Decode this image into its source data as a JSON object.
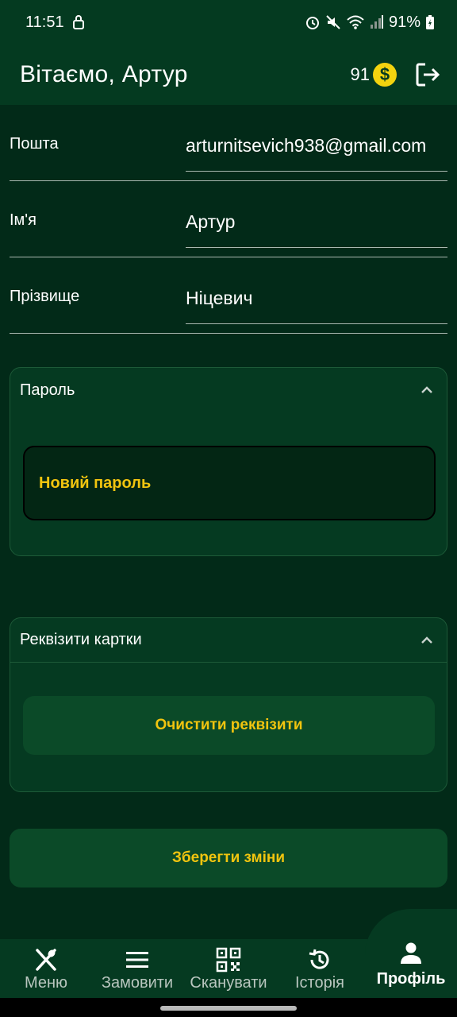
{
  "status": {
    "time": "11:51",
    "battery": "91%"
  },
  "header": {
    "title": "Вітаємо, Артур",
    "balance": "91",
    "coin_symbol": "$"
  },
  "form": {
    "email_label": "Пошта",
    "email_value": "arturnitsevich938@gmail.com",
    "name_label": "Ім'я",
    "name_value": "Артур",
    "surname_label": "Прізвище",
    "surname_value": "Ніцевич"
  },
  "password_section": {
    "title": "Пароль",
    "new_password_label": "Новий пароль"
  },
  "card_section": {
    "title": "Реквізити картки",
    "clear_label": "Очистити реквізити"
  },
  "save_label": "Зберегти зміни",
  "nav": {
    "items": [
      {
        "label": "Меню",
        "icon": "fork-knife-icon"
      },
      {
        "label": "Замовити",
        "icon": "menu-lines-icon"
      },
      {
        "label": "Сканувати",
        "icon": "qr-code-icon"
      },
      {
        "label": "Історія",
        "icon": "history-icon"
      },
      {
        "label": "Профіль",
        "icon": "person-icon"
      }
    ],
    "active": "Профіль"
  },
  "colors": {
    "background": "#022a18",
    "bar": "#043a20",
    "accent": "#f1c40f",
    "coin": "#f4d30f"
  }
}
